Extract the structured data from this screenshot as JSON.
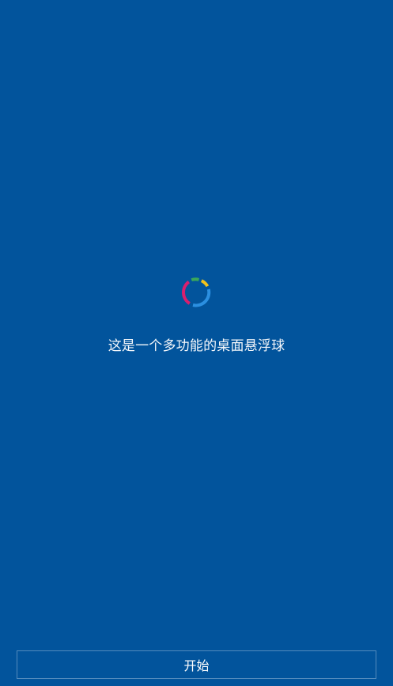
{
  "onboarding": {
    "tagline": "这是一个多功能的桌面悬浮球",
    "start_label": "开始",
    "logo_icon": "circular-ring-logo-icon",
    "colors": {
      "background": "#02549c",
      "ring_green": "#3aa85a",
      "ring_yellow": "#f2c21b",
      "ring_blue": "#2b8fe0",
      "ring_magenta": "#d81f6e"
    }
  }
}
